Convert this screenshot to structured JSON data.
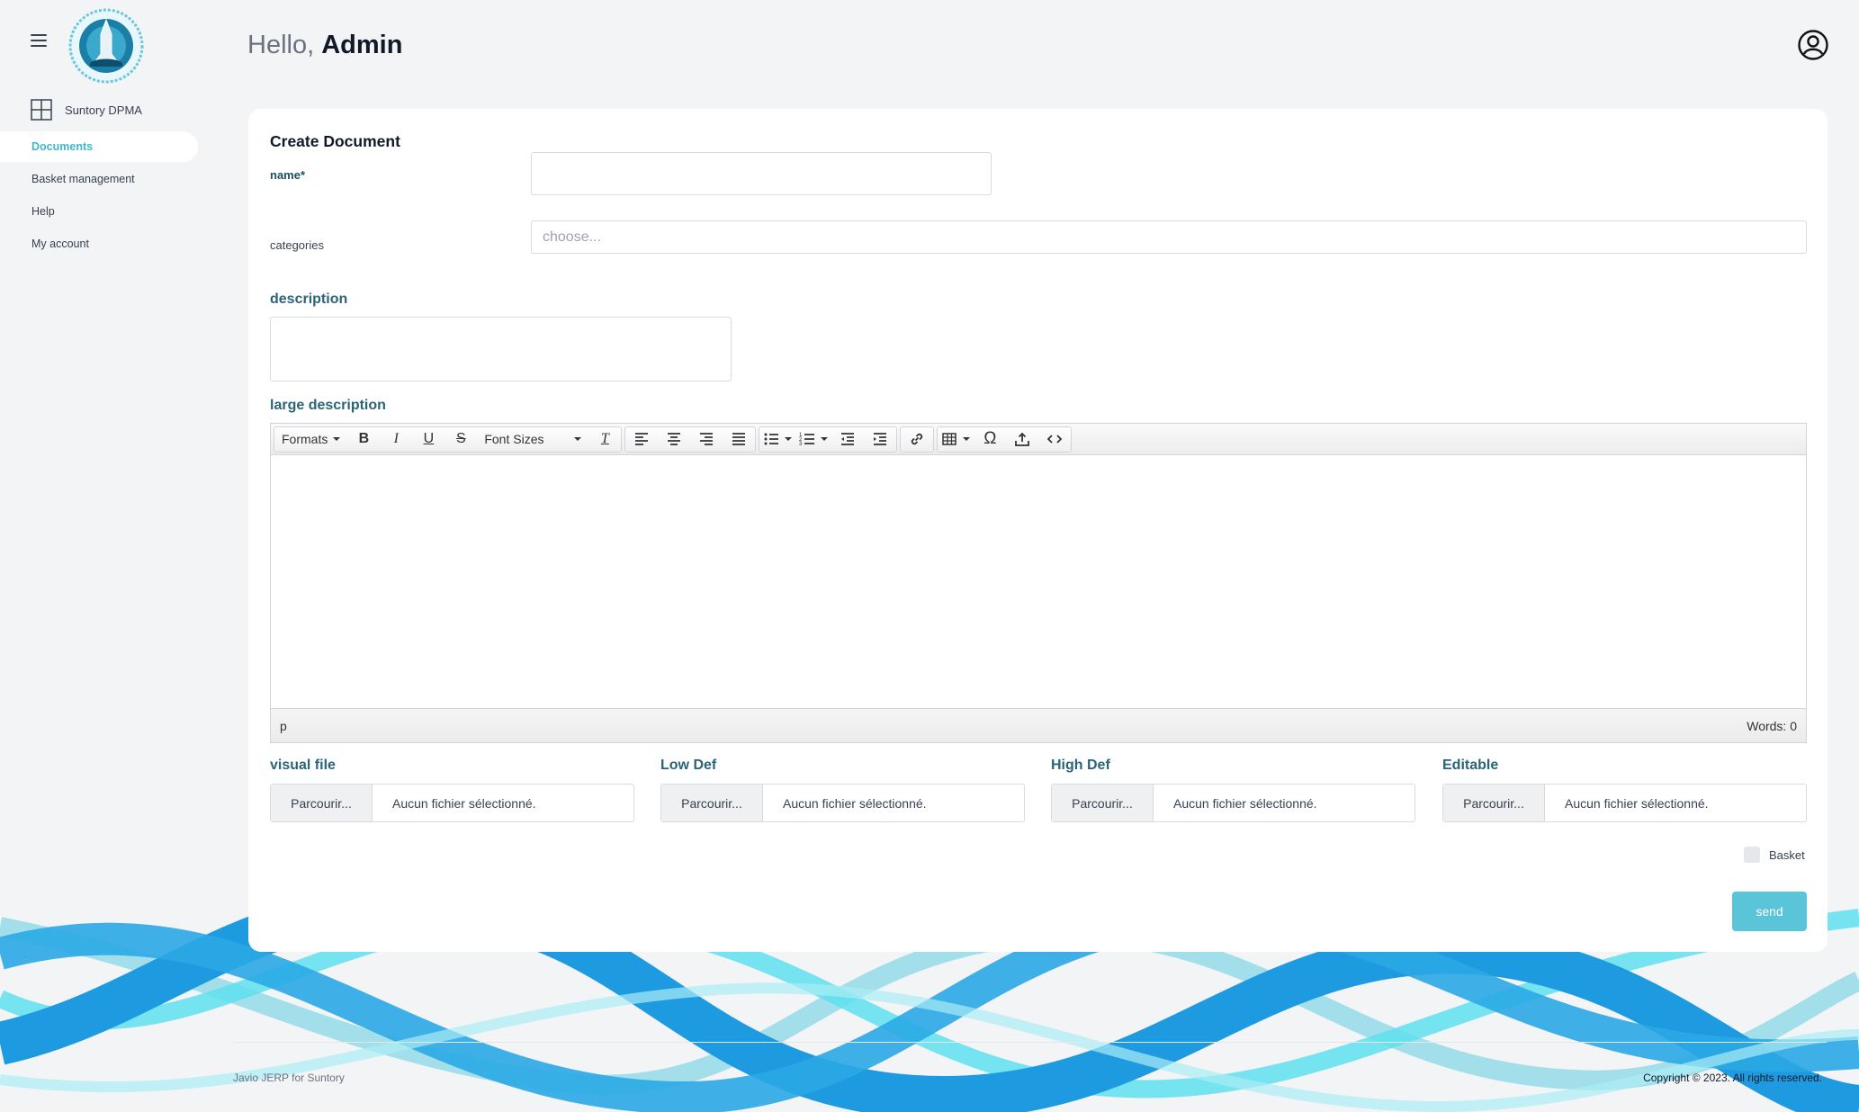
{
  "header": {
    "greeting": "Hello,",
    "user_name": "Admin",
    "user_icon": "user-circle-icon"
  },
  "sidebar": {
    "menu_icon": "hamburger-menu-icon",
    "brand": {
      "icon": "grid-icon",
      "name": "Suntory DPMA"
    },
    "items": [
      {
        "label": "Documents",
        "active": true
      },
      {
        "label": "Basket management",
        "active": false
      },
      {
        "label": "Help",
        "active": false
      },
      {
        "label": "My account",
        "active": false
      }
    ]
  },
  "form": {
    "title": "Create Document",
    "name_label": "name*",
    "name_value": "",
    "categories_label": "categories",
    "categories_placeholder": "choose...",
    "description_label": "description",
    "description_value": "",
    "large_description_label": "large description",
    "editor": {
      "formats_label": "Formats",
      "font_sizes_label": "Font Sizes",
      "status_path": "p",
      "word_count": "Words: 0"
    },
    "files": [
      {
        "label": "visual file",
        "button": "Parcourir...",
        "status": "Aucun fichier sélectionné."
      },
      {
        "label": "Low Def",
        "button": "Parcourir...",
        "status": "Aucun fichier sélectionné."
      },
      {
        "label": "High Def",
        "button": "Parcourir...",
        "status": "Aucun fichier sélectionné."
      },
      {
        "label": "Editable",
        "button": "Parcourir...",
        "status": "Aucun fichier sélectionné."
      }
    ],
    "basket_label": "Basket",
    "basket_checked": false,
    "send_label": "send"
  },
  "footer": {
    "left": "Javio JERP for Suntory",
    "right": "Copyright © 2023. All rights reserved."
  },
  "colors": {
    "accent": "#3fb7cf",
    "send_button": "#5ac4d8",
    "label": "#2a6478",
    "wave_dark": "#1e9be0",
    "wave_light": "#5fe0ee"
  }
}
